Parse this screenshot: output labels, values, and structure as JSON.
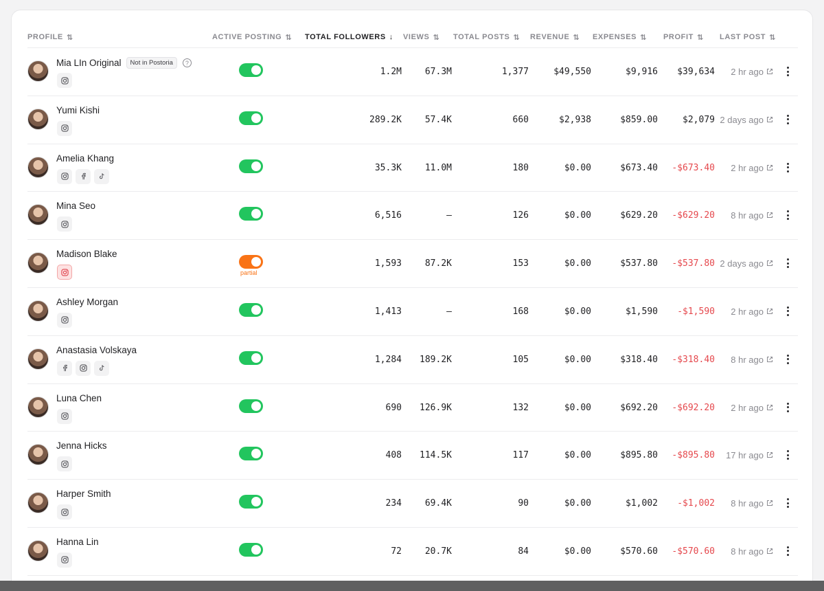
{
  "table": {
    "columns": [
      {
        "key": "profile",
        "label": "PROFILE",
        "sort_icon": "sort-both-icon",
        "active": false
      },
      {
        "key": "active_posting",
        "label": "ACTIVE POSTING",
        "sort_icon": "sort-both-icon",
        "active": false
      },
      {
        "key": "total_followers",
        "label": "TOTAL FOLLOWERS",
        "sort_icon": "sort-desc-icon",
        "active": true
      },
      {
        "key": "views",
        "label": "VIEWS",
        "sort_icon": "sort-both-icon",
        "active": false
      },
      {
        "key": "total_posts",
        "label": "TOTAL POSTS",
        "sort_icon": "sort-both-icon",
        "active": false
      },
      {
        "key": "revenue",
        "label": "REVENUE",
        "sort_icon": "sort-both-icon",
        "active": false
      },
      {
        "key": "expenses",
        "label": "EXPENSES",
        "sort_icon": "sort-both-icon",
        "active": false
      },
      {
        "key": "profit",
        "label": "PROFIT",
        "sort_icon": "sort-both-icon",
        "active": false
      },
      {
        "key": "last_post",
        "label": "LAST POST",
        "sort_icon": "sort-both-icon",
        "active": false
      }
    ],
    "rows": [
      {
        "name": "Mia LIn Original",
        "badge": "Not in Postoria",
        "help_icon": "?",
        "socials": [
          "instagram"
        ],
        "alert_social": false,
        "posting": "on",
        "partial_label": "",
        "followers": "1.2M",
        "views": "67.3M",
        "posts": "1,377",
        "revenue": "$49,550",
        "expenses": "$9,916",
        "profit": "$39,634",
        "profit_negative": false,
        "last_post": "2 hr ago"
      },
      {
        "name": "Yumi Kishi",
        "badge": "",
        "help_icon": "",
        "socials": [
          "instagram"
        ],
        "alert_social": false,
        "posting": "on",
        "partial_label": "",
        "followers": "289.2K",
        "views": "57.4K",
        "posts": "660",
        "revenue": "$2,938",
        "expenses": "$859.00",
        "profit": "$2,079",
        "profit_negative": false,
        "last_post": "2 days ago"
      },
      {
        "name": "Amelia Khang",
        "badge": "",
        "help_icon": "",
        "socials": [
          "instagram",
          "facebook",
          "tiktok"
        ],
        "alert_social": false,
        "posting": "on",
        "partial_label": "",
        "followers": "35.3K",
        "views": "11.0M",
        "posts": "180",
        "revenue": "$0.00",
        "expenses": "$673.40",
        "profit": "-$673.40",
        "profit_negative": true,
        "last_post": "2 hr ago"
      },
      {
        "name": "Mina Seo",
        "badge": "",
        "help_icon": "",
        "socials": [
          "instagram"
        ],
        "alert_social": false,
        "posting": "on",
        "partial_label": "",
        "followers": "6,516",
        "views": "–",
        "posts": "126",
        "revenue": "$0.00",
        "expenses": "$629.20",
        "profit": "-$629.20",
        "profit_negative": true,
        "last_post": "8 hr ago"
      },
      {
        "name": "Madison Blake",
        "badge": "",
        "help_icon": "",
        "socials": [
          "instagram"
        ],
        "alert_social": true,
        "posting": "partial",
        "partial_label": "partial",
        "followers": "1,593",
        "views": "87.2K",
        "posts": "153",
        "revenue": "$0.00",
        "expenses": "$537.80",
        "profit": "-$537.80",
        "profit_negative": true,
        "last_post": "2 days ago"
      },
      {
        "name": "Ashley Morgan",
        "badge": "",
        "help_icon": "",
        "socials": [
          "instagram"
        ],
        "alert_social": false,
        "posting": "on",
        "partial_label": "",
        "followers": "1,413",
        "views": "–",
        "posts": "168",
        "revenue": "$0.00",
        "expenses": "$1,590",
        "profit": "-$1,590",
        "profit_negative": true,
        "last_post": "2 hr ago"
      },
      {
        "name": "Anastasia Volskaya",
        "badge": "",
        "help_icon": "",
        "socials": [
          "facebook",
          "instagram",
          "tiktok"
        ],
        "alert_social": false,
        "posting": "on",
        "partial_label": "",
        "followers": "1,284",
        "views": "189.2K",
        "posts": "105",
        "revenue": "$0.00",
        "expenses": "$318.40",
        "profit": "-$318.40",
        "profit_negative": true,
        "last_post": "8 hr ago"
      },
      {
        "name": "Luna Chen",
        "badge": "",
        "help_icon": "",
        "socials": [
          "instagram"
        ],
        "alert_social": false,
        "posting": "on",
        "partial_label": "",
        "followers": "690",
        "views": "126.9K",
        "posts": "132",
        "revenue": "$0.00",
        "expenses": "$692.20",
        "profit": "-$692.20",
        "profit_negative": true,
        "last_post": "2 hr ago"
      },
      {
        "name": "Jenna Hicks",
        "badge": "",
        "help_icon": "",
        "socials": [
          "instagram"
        ],
        "alert_social": false,
        "posting": "on",
        "partial_label": "",
        "followers": "408",
        "views": "114.5K",
        "posts": "117",
        "revenue": "$0.00",
        "expenses": "$895.80",
        "profit": "-$895.80",
        "profit_negative": true,
        "last_post": "17 hr ago"
      },
      {
        "name": "Harper Smith",
        "badge": "",
        "help_icon": "",
        "socials": [
          "instagram"
        ],
        "alert_social": false,
        "posting": "on",
        "partial_label": "",
        "followers": "234",
        "views": "69.4K",
        "posts": "90",
        "revenue": "$0.00",
        "expenses": "$1,002",
        "profit": "-$1,002",
        "profit_negative": true,
        "last_post": "8 hr ago"
      },
      {
        "name": "Hanna Lin",
        "badge": "",
        "help_icon": "",
        "socials": [
          "instagram"
        ],
        "alert_social": false,
        "posting": "on",
        "partial_label": "",
        "followers": "72",
        "views": "20.7K",
        "posts": "84",
        "revenue": "$0.00",
        "expenses": "$570.60",
        "profit": "-$570.60",
        "profit_negative": true,
        "last_post": "8 hr ago"
      }
    ]
  },
  "colors": {
    "toggle_on": "#22c55e",
    "toggle_partial": "#f97316",
    "negative": "#e5484d",
    "muted": "#8a8a90"
  }
}
